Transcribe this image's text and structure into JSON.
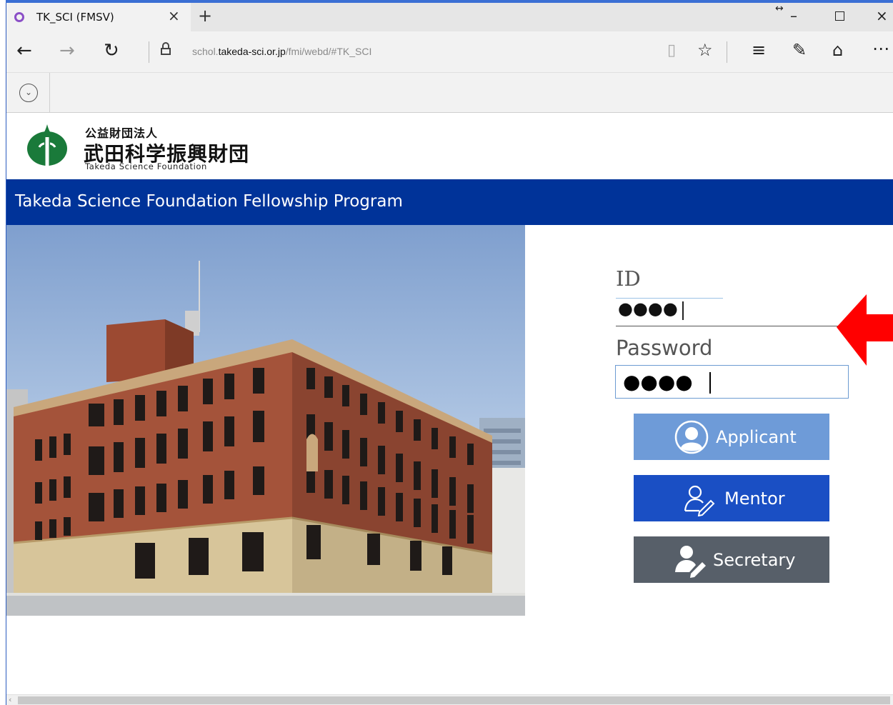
{
  "browser": {
    "tab_title": "TK_SCI (FMSV)",
    "tab_close": "×",
    "new_tab": "+",
    "window_controls": {
      "resize": "↔",
      "minimize": "–",
      "close": "×"
    },
    "url": {
      "prefix": "schol.",
      "host": "takeda-sci.or.jp",
      "path": "/fmi/webd/#TK_SCI"
    },
    "icons": [
      "back-icon",
      "forward-icon",
      "refresh-icon",
      "lock-icon",
      "reading-view-icon",
      "favorite-star-icon",
      "hub-icon",
      "web-note-icon",
      "share-icon",
      "more-icon",
      "extension-chevron-icon"
    ]
  },
  "header": {
    "org_type_jp": "公益財団法人",
    "org_name_jp": "武田科学振興財団",
    "org_name_en": "Takeda Science Foundation",
    "logo_color": "#1a7a3a"
  },
  "banner": {
    "title": "Takeda Science Foundation Fellowship Program",
    "color": "#003399"
  },
  "login": {
    "id_label": "ID",
    "id_value": "●●●●",
    "password_label": "Password",
    "password_value": "●●●●",
    "buttons": {
      "applicant": "Applicant",
      "mentor": "Mentor",
      "secretary": "Secretary"
    },
    "button_colors": {
      "applicant": "#6e9bd8",
      "mentor": "#1a4fc4",
      "secretary": "#575f69"
    }
  },
  "annotation": {
    "arrow_color": "#ff0000"
  }
}
